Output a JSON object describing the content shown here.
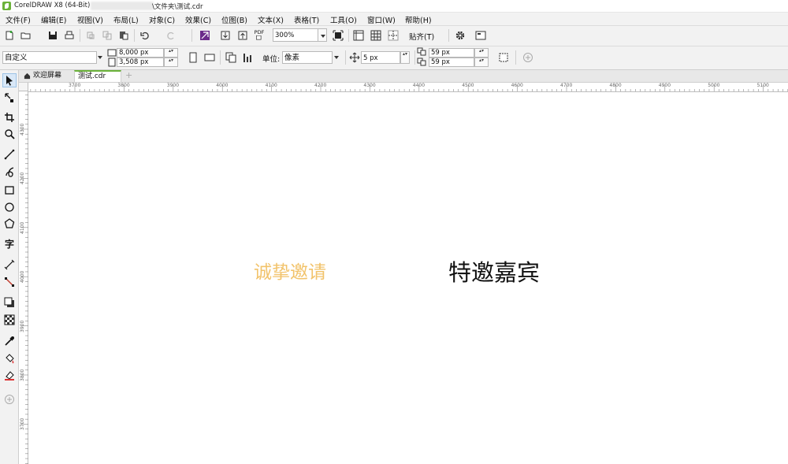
{
  "titlebar": {
    "title": "CorelDRAW X8 (64-Bit) -",
    "path_suffix": "\\文件夹\\测试.cdr"
  },
  "menu": [
    "文件(F)",
    "编辑(E)",
    "视图(V)",
    "布局(L)",
    "对象(C)",
    "效果(C)",
    "位图(B)",
    "文本(X)",
    "表格(T)",
    "工具(O)",
    "窗口(W)",
    "帮助(H)"
  ],
  "toolbar": {
    "pdf_label": "PDF",
    "zoom": "300%",
    "snap_label": "贴齐(T)"
  },
  "propertybar": {
    "page_preset": "自定义",
    "width": "8,000 px",
    "height": "3,508 px",
    "units_label": "单位:",
    "units_value": "像素",
    "nudge": "5 px",
    "dup_x": "59 px",
    "dup_y": "59 px"
  },
  "tabs": {
    "welcome": "欢迎屏幕",
    "document": "测试.cdr"
  },
  "ruler_h": [
    "3700",
    "3800",
    "3900",
    "4000",
    "4100",
    "4200",
    "4300",
    "4400",
    "4500",
    "4600",
    "4700",
    "4800",
    "4900",
    "5000",
    "5100"
  ],
  "ruler_v": [
    "4300",
    "4200",
    "4100",
    "4000",
    "3900",
    "3800",
    "3700"
  ],
  "canvas": {
    "text1": "诚挚邀请",
    "text1_color": "#f2c36b",
    "text2": "特邀嘉宾",
    "text2_color": "#111111"
  },
  "colors": {
    "accent": "#6bb23a",
    "chrome": "#f2f2f2"
  }
}
